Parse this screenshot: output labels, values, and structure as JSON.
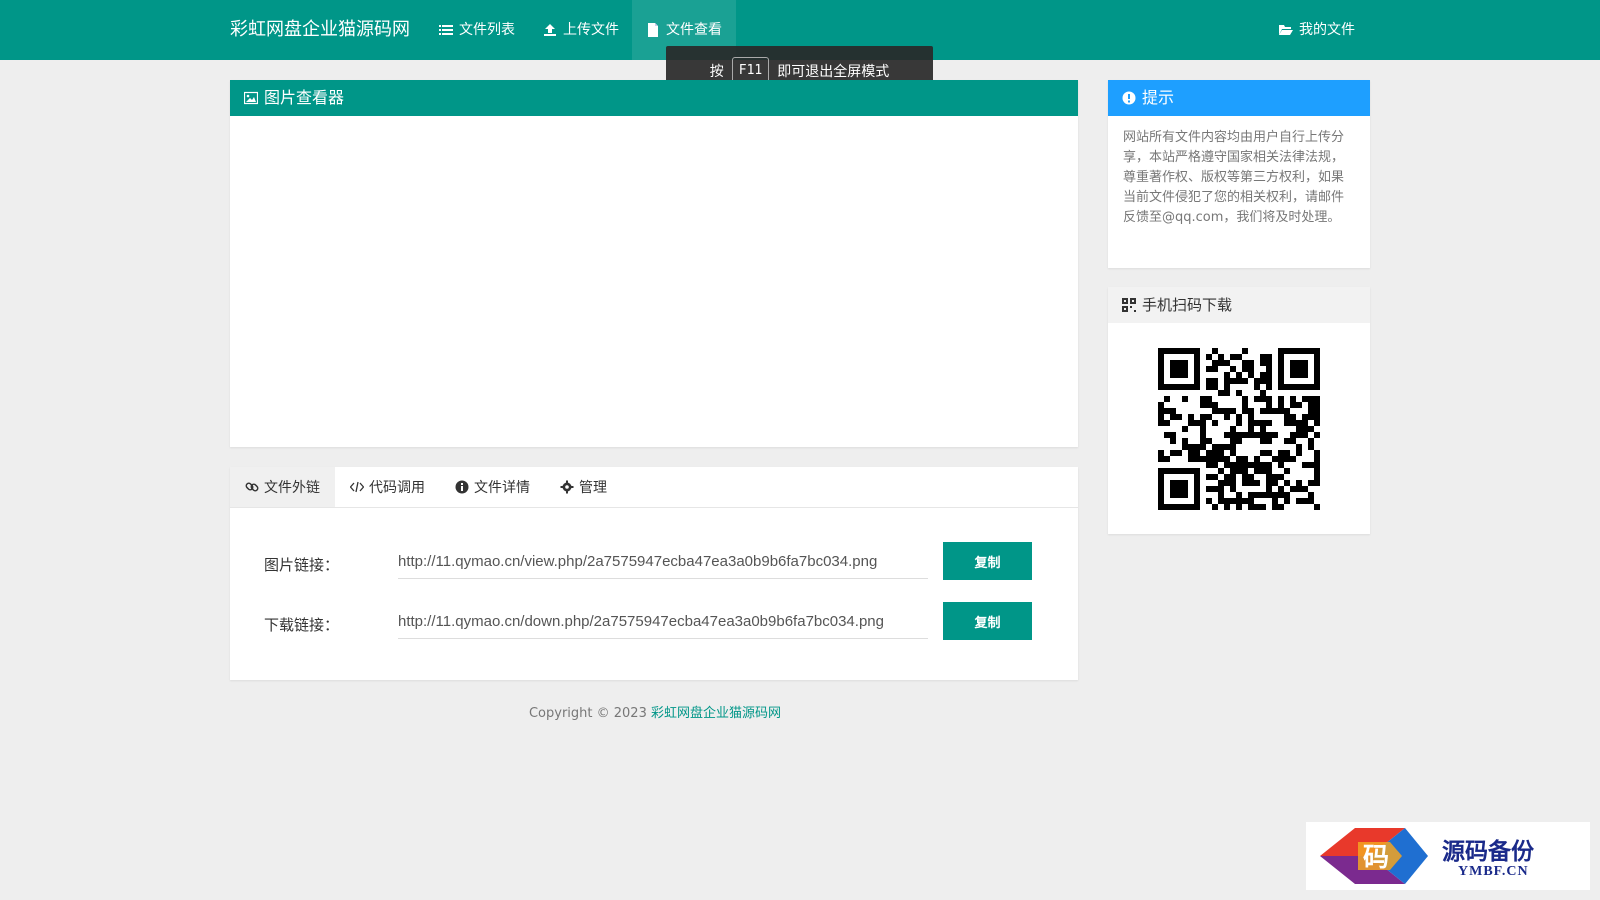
{
  "nav": {
    "brand": "彩虹网盘企业猫源码网",
    "files": "文件列表",
    "upload": "上传文件",
    "view": "文件查看",
    "mine": "我的文件"
  },
  "fullscreen_tip": {
    "before": "按",
    "key": "F11",
    "after": "即可退出全屏模式"
  },
  "viewer": {
    "title": "图片查看器"
  },
  "notice": {
    "title": "提示",
    "text": "网站所有文件内容均由用户自行上传分享，本站严格遵守国家相关法律法规，尊重著作权、版权等第三方权利，如果当前文件侵犯了您的相关权利，请邮件反馈至@qq.com，我们将及时处理。"
  },
  "qr": {
    "title": "手机扫码下载"
  },
  "tabs": [
    "文件外链",
    "代码调用",
    "文件详情",
    "管理"
  ],
  "links": {
    "image_label": "图片链接：",
    "image_url": "http://11.qymao.cn/view.php/2a7575947ecba47ea3a0b9b6fa7bc034.png",
    "download_label": "下载链接：",
    "download_url": "http://11.qymao.cn/down.php/2a7575947ecba47ea3a0b9b6fa7bc034.png",
    "copy": "复制"
  },
  "footer": {
    "copyright": "Copyright © 2023 ",
    "site": "彩虹网盘企业猫源码网"
  },
  "watermark": {
    "cn": "源码备份",
    "en": "YMBF.CN",
    "logo_char": "码"
  },
  "colors": {
    "primary": "#009688",
    "info": "#1e9fff"
  }
}
